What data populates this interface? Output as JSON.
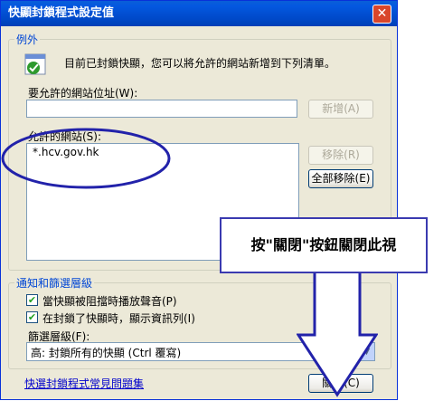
{
  "window": {
    "title": "快顯封鎖程式設定值",
    "close_glyph": "✕"
  },
  "exceptions": {
    "group_title": "例外",
    "info_text": "目前已封鎖快顯，您可以將允許的網站新增到下列清單。",
    "address_label": "要允許的網站位址(W):",
    "address_value": "",
    "add_button": "新增(A)",
    "allowed_label": "允許的網站(S):",
    "allowed_sites": [
      "*.hcv.gov.hk"
    ],
    "remove_button": "移除(R)",
    "remove_all_button": "全部移除(E)"
  },
  "notifications": {
    "group_title": "通知和篩選層級",
    "play_sound_label": "當快顯被阻擋時播放聲音(P)",
    "play_sound_checked": true,
    "show_bar_label": "在封鎖了快顯時，顯示資訊列(I)",
    "show_bar_checked": true,
    "filter_label": "篩選層級(F):",
    "filter_value": "高: 封鎖所有的快顯 (Ctrl 覆寫)"
  },
  "footer": {
    "faq_link": "快選封鎖程式常見問題集",
    "close_button": "關閉(C)"
  },
  "annotation": {
    "callout_text": "按\"關閉\"按鈕關閉此視"
  },
  "colors": {
    "titlebar": "#0054e3",
    "window_bg": "#ece9d8",
    "annotation": "#2222aa"
  }
}
